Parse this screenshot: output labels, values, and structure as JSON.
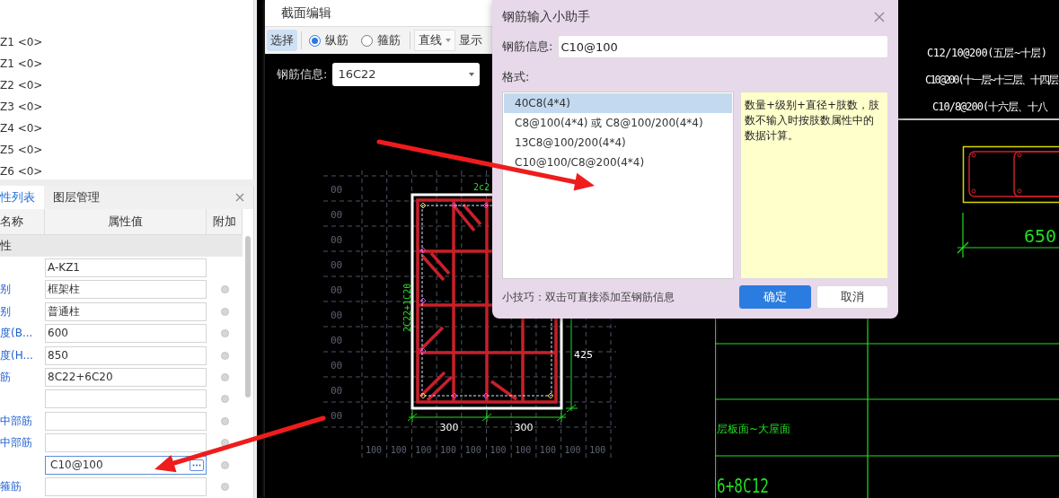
{
  "tree": {
    "items": [
      "Z1 <0>",
      "Z1 <0>",
      "Z2 <0>",
      "Z3 <0>",
      "Z4 <0>",
      "Z5 <0>",
      "Z6 <0>"
    ]
  },
  "property_panel": {
    "tabs": [
      {
        "label": "性列表",
        "selected": true
      },
      {
        "label": "图层管理",
        "selected": false
      }
    ],
    "columns": [
      "名称",
      "属性值",
      "附加"
    ],
    "group": "性",
    "rows": [
      {
        "value": "A-KZ1",
        "attach": false,
        "focused": false
      },
      {
        "name": "别",
        "value": "框架柱",
        "attach": true,
        "focused": false
      },
      {
        "name": "别",
        "value": "普通柱",
        "attach": true,
        "focused": false
      },
      {
        "name": "度(B...",
        "value": "600",
        "attach": true,
        "focused": false
      },
      {
        "name": "度(H...",
        "value": "850",
        "attach": true,
        "focused": false
      },
      {
        "name": "筋",
        "value": "8C22+6C20",
        "attach": true,
        "focused": false
      },
      {
        "attach": true,
        "focused": false
      },
      {
        "name": "中部筋",
        "attach": true,
        "focused": false
      },
      {
        "name": "中部筋",
        "attach": true,
        "focused": false
      },
      {
        "value": "C10@100",
        "attach": true,
        "focused": true
      },
      {
        "name": "箍筋",
        "attach": true,
        "focused": false
      }
    ]
  },
  "section_editor": {
    "title": "截面编辑",
    "tools": [
      {
        "kind": "button",
        "label": "选择",
        "selected": true
      },
      {
        "kind": "radio",
        "label": "纵筋",
        "selected": true
      },
      {
        "kind": "radio",
        "label": "箍筋",
        "selected": false
      },
      {
        "kind": "dropdown",
        "label": "直线"
      },
      {
        "kind": "text",
        "label": "显示"
      }
    ],
    "rebar_label": "钢筋信息:",
    "rebar_value": "16C22",
    "drawing": {
      "left_labels": [
        "00",
        "00",
        "00",
        "00",
        "00",
        "00",
        "00",
        "00",
        "00",
        "00"
      ],
      "bottom_labels": [
        "100",
        "100",
        "100",
        "100",
        "100",
        "100",
        "100",
        "100",
        "100",
        "100"
      ],
      "side_note": "2C22+1C20",
      "top_note": "2c2",
      "width_dims": [
        "300",
        "300"
      ],
      "height_dim": "425"
    }
  },
  "dialog": {
    "title": "钢筋输入小助手",
    "field_label": "钢筋信息:",
    "field_value": "C10@100",
    "format_label": "格式:",
    "formats": [
      {
        "text": "40C8(4*4)",
        "selected": true
      },
      {
        "text": "C8@100(4*4) 或 C8@100/200(4*4)",
        "selected": false
      },
      {
        "text": "13C8@100/200(4*4)",
        "selected": false
      },
      {
        "text": "C10@100/C8@200(4*4)",
        "selected": false
      }
    ],
    "description": "数量+级别+直径+肢数，肢数不输入时按肢数属性中的数据计算。",
    "tip": "小技巧：双击可直接添加至钢筋信息",
    "buttons": [
      {
        "label": "确定",
        "kind": "primary"
      },
      {
        "label": "取消",
        "kind": "default"
      }
    ]
  },
  "cad": {
    "notes": [
      "C12/10@200(五层~十层)",
      "C10@200(十一层~十三层、十四层",
      "C10/8@200(十六层、十八"
    ],
    "dim": "650",
    "floor_range": "层板面~大屋面",
    "rebar": "6+8C12"
  }
}
